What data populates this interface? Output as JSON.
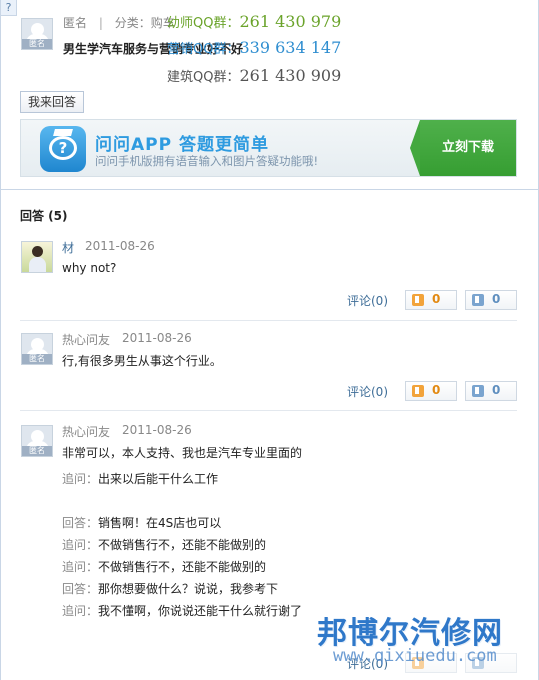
{
  "help_corner": "?",
  "question": {
    "author": "匿名",
    "category_prefix": "分类：购车",
    "title": "男生学汽车服务与营销专业好不好",
    "avatar_tag": "匿名"
  },
  "watermarks": {
    "line1_name": "幼师QQ群：",
    "line1_num": "261 430 979",
    "line2_name": "营销QQ群：",
    "line2_num": "339 634 147",
    "line3_name": "建筑QQ群：",
    "line3_num": "261 430 909"
  },
  "answer_button": "我来回答",
  "banner": {
    "icon": "question-bubble-icon",
    "title": "问问APP 答题更简单",
    "subtitle": "问问手机版拥有语音输入和图片答疑功能哦!",
    "download": "立刻下载"
  },
  "answers_heading": "回答 (5)",
  "answers": [
    {
      "name": "材",
      "date": "2011-08-26",
      "text": "why not?",
      "comment": "评论(0)",
      "up": "0",
      "down": "0"
    },
    {
      "name": "热心问友",
      "date": "2011-08-26",
      "text": "行,有很多男生从事这个行业。",
      "comment": "评论(0)",
      "up": "0",
      "down": "0",
      "avatar_tag": "匿名"
    },
    {
      "name": "热心问友",
      "date": "2011-08-26",
      "text": "非常可以，本人支持、我也是汽车专业里面的",
      "avatar_tag": "匿名",
      "followups": [
        {
          "label": "追问：",
          "text": "出来以后能干什么工作"
        },
        {
          "label": "回答：",
          "text": "销售啊！在4S店也可以"
        },
        {
          "label": "追问：",
          "text": "不做销售行不，还能不能做别的"
        },
        {
          "label": "追问：",
          "text": "不做销售行不，还能不能做别的"
        },
        {
          "label": "回答：",
          "text": "那你想要做什么？说说，我参考下"
        },
        {
          "label": "追问：",
          "text": "我不懂啊，你说说还能干什么就行谢了"
        }
      ],
      "comment": "评论(0)"
    }
  ],
  "brand": {
    "name": "邦博尔汽修网",
    "url": "www.qixiuedu.com"
  },
  "colors": {
    "link": "#3f6e98",
    "banner_accent": "#2e9be0",
    "download_green": "#3aa336",
    "brand_blue": "#2f78c9"
  }
}
